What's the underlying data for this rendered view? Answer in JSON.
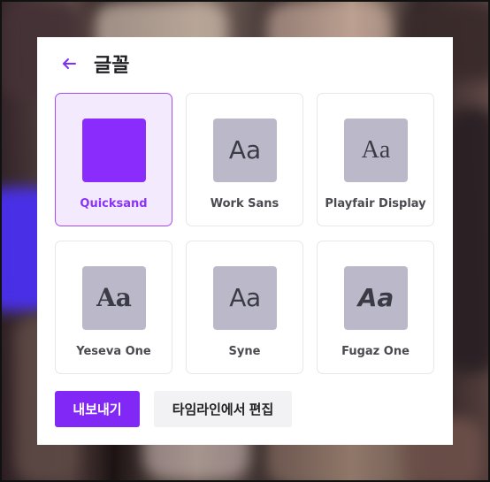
{
  "header": {
    "title": "글꼴"
  },
  "fonts": [
    {
      "name": "Quicksand",
      "selected": true
    },
    {
      "name": "Work Sans",
      "sample": "Aa"
    },
    {
      "name": "Playfair Display",
      "sample": "Aa"
    },
    {
      "name": "Yeseva One",
      "sample": "Aa"
    },
    {
      "name": "Syne",
      "sample": "Aa"
    },
    {
      "name": "Fugaz One",
      "sample": "Aa"
    }
  ],
  "actions": {
    "export_label": "내보내기",
    "edit_timeline_label": "타임라인에서 편집"
  },
  "colors": {
    "accent": "#8228f6",
    "selected_border": "#a34cf5",
    "selected_bg": "#f4eafe",
    "preview_bg": "#bbb9c9"
  },
  "icons": {
    "back": "back-arrow-icon"
  }
}
